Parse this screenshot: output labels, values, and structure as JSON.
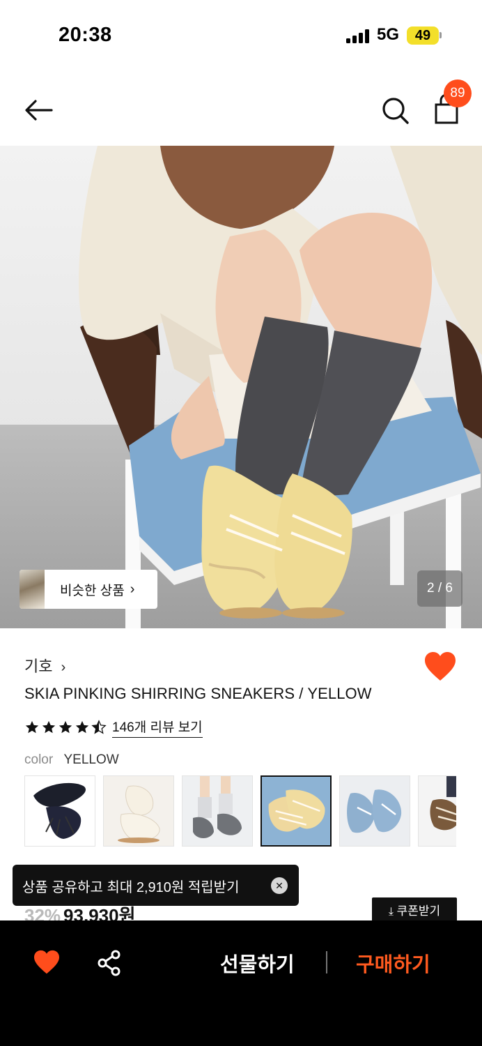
{
  "status_bar": {
    "time": "20:38",
    "network": "5G",
    "battery": "49"
  },
  "header": {
    "cart_count": "89"
  },
  "gallery": {
    "page_indicator": "2 / 6",
    "similar_label": "비슷한 상품"
  },
  "product": {
    "brand": "기호",
    "brand_chevron": "›",
    "name": "SKIA PINKING SHIRRING SNEAKERS / YELLOW",
    "rating": 4.5,
    "review_link": "146개 리뷰 보기",
    "option_key": "color",
    "option_value": "YELLOW",
    "swatches": [
      "black",
      "ivory",
      "gray",
      "yellow",
      "blue",
      "brown"
    ],
    "selected_swatch": "yellow",
    "liked": true
  },
  "price": {
    "discount": "32%",
    "amount": "93,930원"
  },
  "coupon": {
    "label": "쿠폰받기"
  },
  "toast": {
    "text": "상품 공유하고 최대 2,910원 적립받기",
    "close": "✕"
  },
  "bottom_bar": {
    "gift_label": "선물하기",
    "buy_label": "구매하기"
  },
  "colors": {
    "accent": "#ff4d1c",
    "buy": "#ff5a1f",
    "dark": "#000000"
  }
}
